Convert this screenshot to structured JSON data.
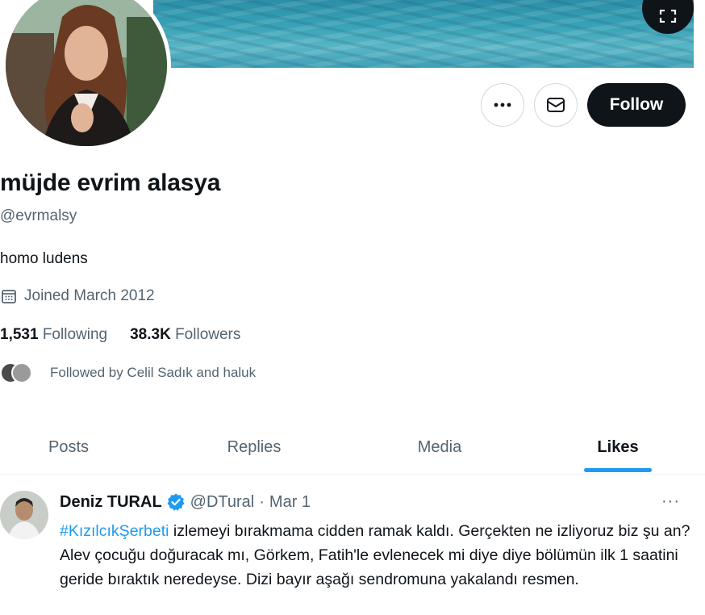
{
  "profile": {
    "display_name": "müjde evrim alasya",
    "handle": "@evrmalsy",
    "bio": "homo ludens",
    "joined": "Joined March 2012",
    "following_count": "1,531",
    "following_label": "Following",
    "followers_count": "38.3K",
    "followers_label": "Followers",
    "followed_by": "Followed by Celil Sadık and haluk"
  },
  "actions": {
    "more_icon": "more-icon",
    "message_icon": "mail-icon",
    "follow_label": "Follow",
    "fullscreen_icon": "expand-icon"
  },
  "tabs": [
    {
      "label": "Posts",
      "active": false
    },
    {
      "label": "Replies",
      "active": false
    },
    {
      "label": "Media",
      "active": false
    },
    {
      "label": "Likes",
      "active": true
    }
  ],
  "tweet": {
    "author_name": "Deniz TURAL",
    "verified": true,
    "author_handle": "@DTural",
    "separator": "·",
    "date": "Mar 1",
    "hashtag": "#KızılcıkŞerbeti",
    "text": " izlemeyi bırakmama cidden ramak kaldı. Gerçekten ne izliyoruz biz şu an? Alev çocuğu doğuracak mı, Görkem, Fatih'le evlenecek mi diye diye bölümün ilk 1 saatini geride bıraktık neredeyse. Dizi bayır aşağı sendromuna yakalandı resmen.",
    "more": "···"
  },
  "colors": {
    "accent": "#1d9bf0",
    "text": "#0f1419",
    "secondary": "#536471",
    "border": "#cfd9de"
  }
}
